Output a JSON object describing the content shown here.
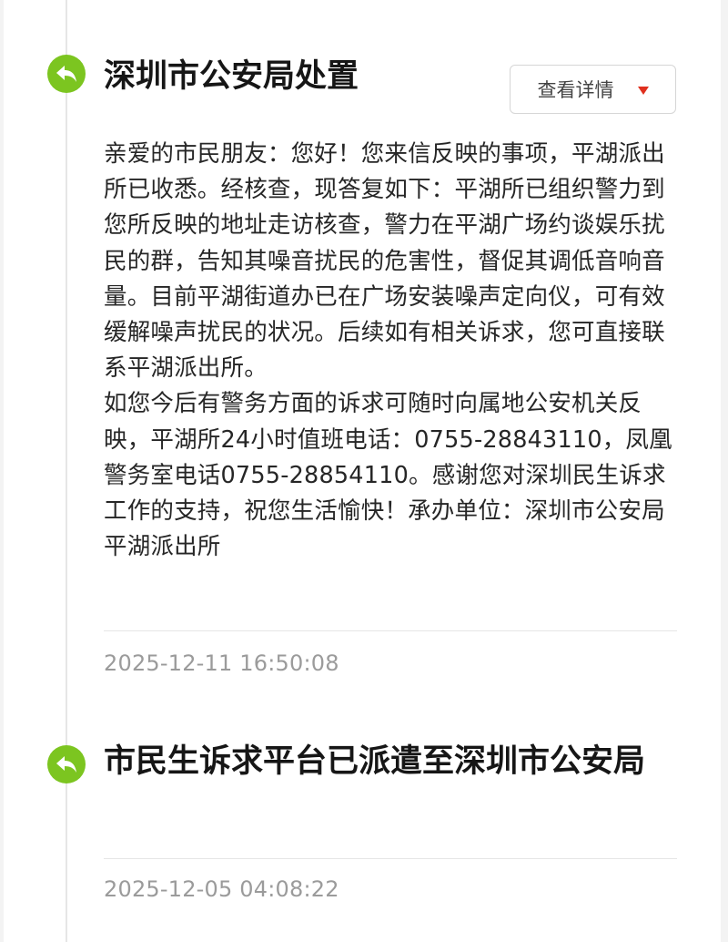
{
  "timeline": [
    {
      "icon": "reply-arrow-icon",
      "title": "深圳市公安局处置",
      "detail_button": "查看详情",
      "body_paragraphs": [
        "亲爱的市民朋友：您好！您来信反映的事项，平湖派出所已收悉。经核查，现答复如下：平湖所已组织警力到您所反映的地址走访核查，警力在平湖广场约谈娱乐扰民的群，告知其噪音扰民的危害性，督促其调低音响音量。目前平湖街道办已在广场安装噪声定向仪，可有效缓解噪声扰民的状况。后续如有相关诉求，您可直接联系平湖派出所。",
        "如您今后有警务方面的诉求可随时向属地公安机关反映，平湖所24小时值班电话：0755-28843110，凤凰警务室电话0755-28854110。感谢您对深圳民生诉求工作的支持，祝您生活愉快！承办单位：深圳市公安局平湖派出所"
      ],
      "timestamp": "2025-12-11 16:50:08"
    },
    {
      "icon": "reply-arrow-icon",
      "title": "市民生诉求平台已派遣至深圳市公安局",
      "timestamp": "2025-12-05 04:08:22"
    }
  ],
  "colors": {
    "accent_green": "#7cc520",
    "caret_red": "#e0301e",
    "timestamp_gray": "#9b9b9b"
  }
}
